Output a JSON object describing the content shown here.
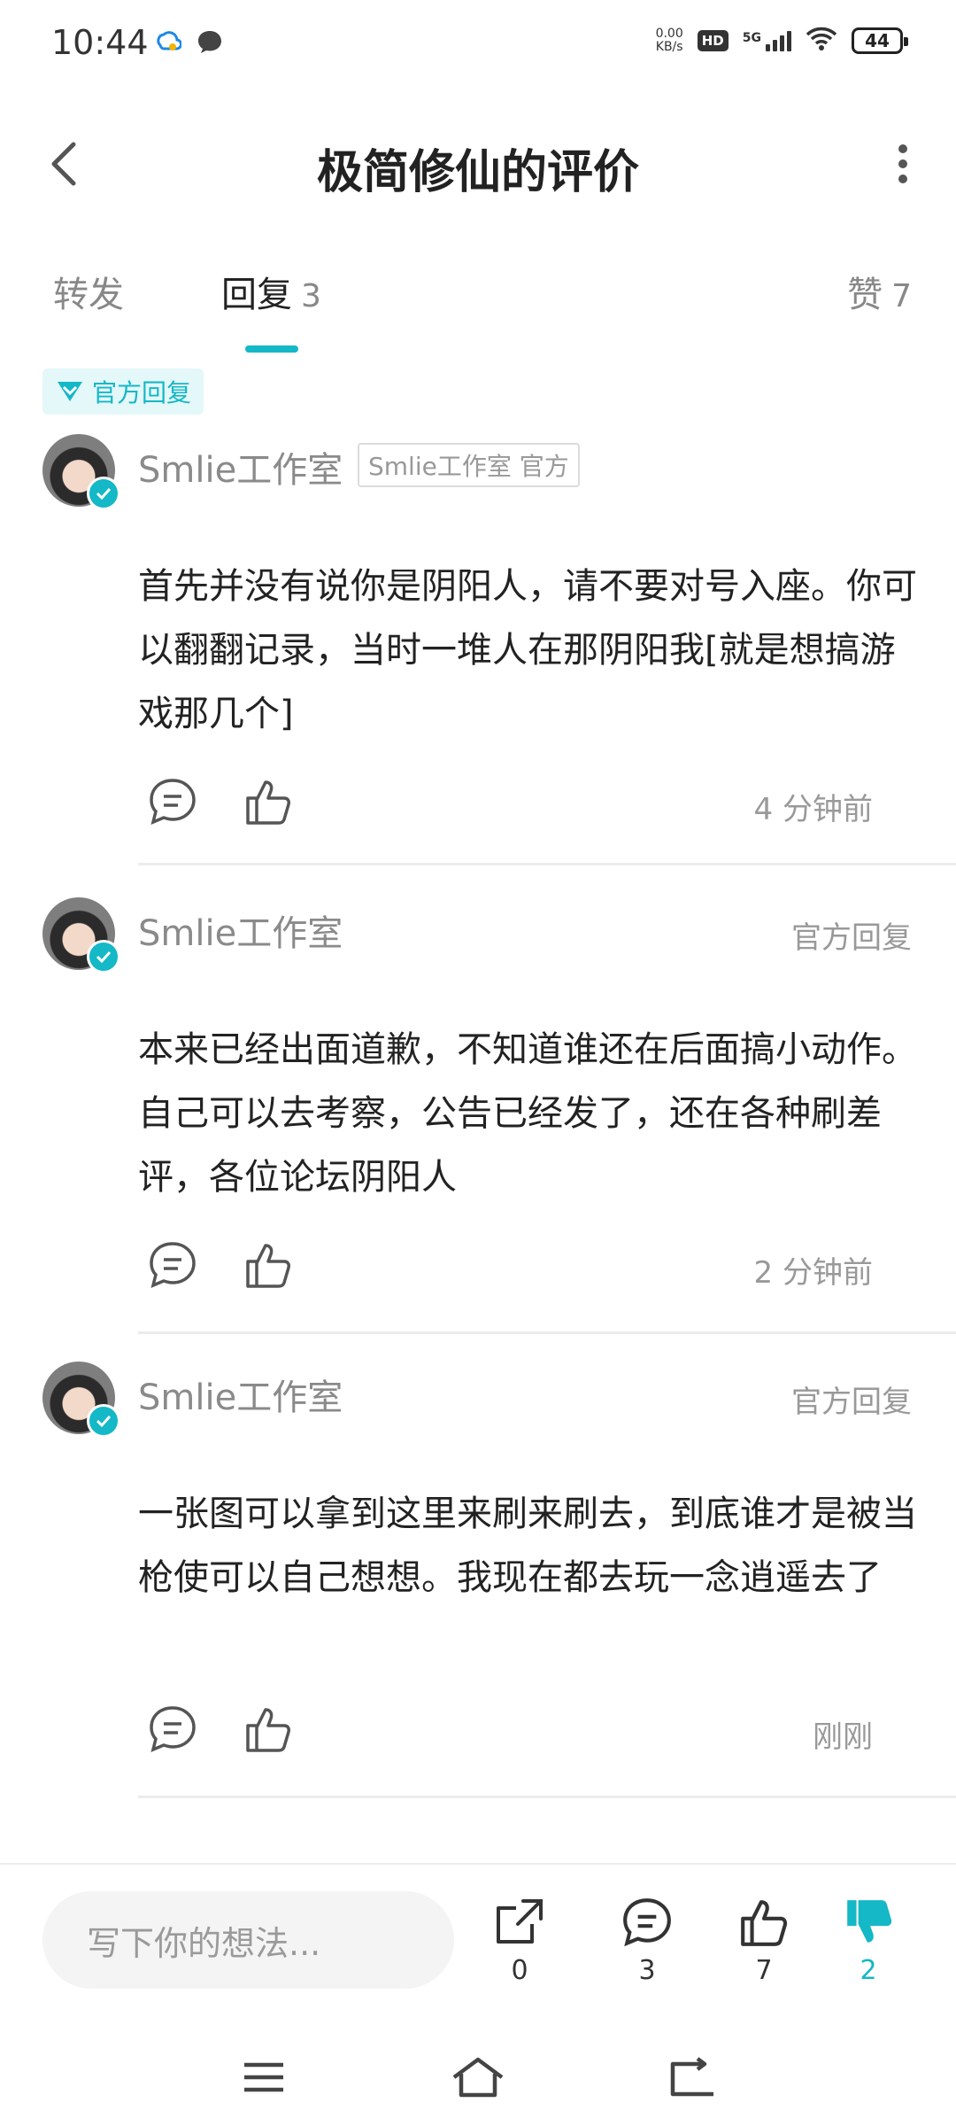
{
  "status_bar": {
    "time": "10:44",
    "net_speed_top": "0.00",
    "net_speed_bottom": "KB/s",
    "hd": "HD",
    "network": "5G",
    "battery": "44"
  },
  "header": {
    "title": "极简修仙的评价"
  },
  "tabs": [
    {
      "label": "转发",
      "count": ""
    },
    {
      "label": "回复",
      "count": "3"
    },
    {
      "label": "赞",
      "count": "7"
    }
  ],
  "badge": {
    "label": "官方回复"
  },
  "comments": [
    {
      "author": "Smlie工作室",
      "author_tag": "Smlie工作室 官方",
      "right_tag": "",
      "content": "首先并没有说你是阴阳人，请不要对号入座。你可以翻翻记录，当时一堆人在那阴阳我[就是想搞游戏那几个]",
      "time": "4 分钟前"
    },
    {
      "author": "Smlie工作室",
      "author_tag": "",
      "right_tag": "官方回复",
      "content": "本来已经出面道歉，不知道谁还在后面搞小动作。自己可以去考察，公告已经发了，还在各种刷差评，各位论坛阴阳人",
      "time": "2 分钟前"
    },
    {
      "author": "Smlie工作室",
      "author_tag": "",
      "right_tag": "官方回复",
      "content": "一张图可以拿到这里来刷来刷去，到底谁才是被当枪使可以自己想想。我现在都去玩一念逍遥去了",
      "time": "刚刚"
    }
  ],
  "bottom_bar": {
    "placeholder": "写下你的想法...",
    "share_count": "0",
    "comment_count": "3",
    "like_count": "7",
    "dislike_count": "2"
  },
  "colors": {
    "accent": "#14b8c6",
    "text": "#222222",
    "muted": "#999999"
  }
}
